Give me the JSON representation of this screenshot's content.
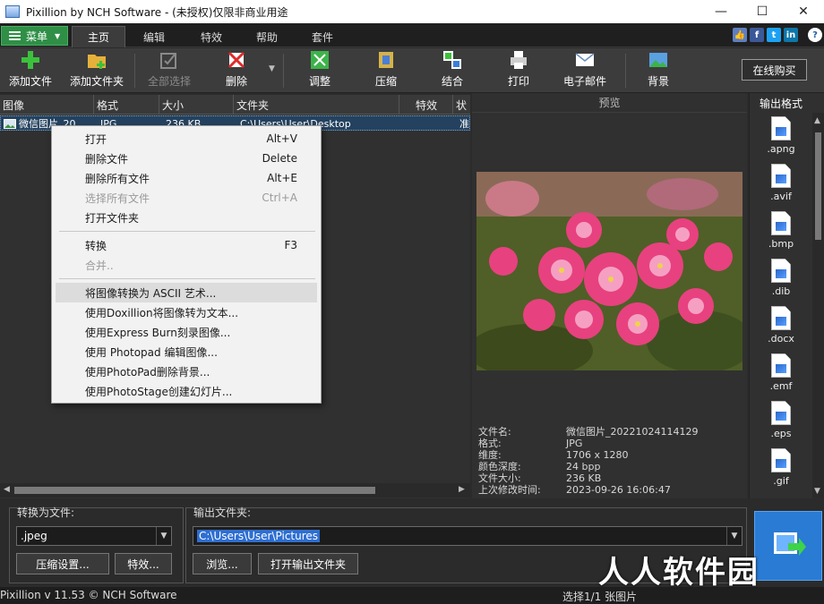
{
  "window": {
    "title": "Pixillion by NCH Software - (未授权)仅限非商业用途",
    "minimize": "—",
    "maximize": "☐",
    "close": "✕"
  },
  "tabs": {
    "menu_label": "菜单",
    "items": [
      "主页",
      "编辑",
      "特效",
      "帮助",
      "套件"
    ]
  },
  "social_icons": [
    "like-icon",
    "facebook-icon",
    "twitter-icon",
    "linkedin-icon",
    "help-icon"
  ],
  "toolbar": {
    "add_file": "添加文件",
    "add_folder": "添加文件夹",
    "select_all": "全部选择",
    "delete": "删除",
    "adjust": "调整",
    "compress": "压缩",
    "combine": "结合",
    "print": "打印",
    "email": "电子邮件",
    "background": "背景",
    "buy_online": "在线购买"
  },
  "file_list": {
    "columns": [
      "图像",
      "格式",
      "大小",
      "文件夹",
      "特效",
      "状"
    ],
    "rows": [
      {
        "name": "微信图片_20...",
        "format": "JPG",
        "size": "236 KB",
        "folder": "C:\\Users\\User\\Desktop",
        "effects": "",
        "status": "准"
      }
    ]
  },
  "context_menu": {
    "items": [
      {
        "label": "打开",
        "shortcut": "Alt+V",
        "enabled": true
      },
      {
        "label": "删除文件",
        "shortcut": "Delete",
        "enabled": true
      },
      {
        "label": "删除所有文件",
        "shortcut": "Alt+E",
        "enabled": true
      },
      {
        "label": "选择所有文件",
        "shortcut": "Ctrl+A",
        "enabled": false
      },
      {
        "label": "打开文件夹",
        "shortcut": "",
        "enabled": true
      },
      {
        "label": "转换",
        "shortcut": "F3",
        "enabled": true
      },
      {
        "label": "合并..",
        "shortcut": "",
        "enabled": false
      },
      {
        "label": "将图像转换为 ASCII 艺术...",
        "shortcut": "",
        "enabled": true
      },
      {
        "label": "使用Doxillion将图像转为文本...",
        "shortcut": "",
        "enabled": true
      },
      {
        "label": "使用Express Burn刻录图像...",
        "shortcut": "",
        "enabled": true
      },
      {
        "label": "使用 Photopad 编辑图像...",
        "shortcut": "",
        "enabled": true
      },
      {
        "label": "使用PhotoPad删除背景...",
        "shortcut": "",
        "enabled": true
      },
      {
        "label": "使用PhotoStage创建幻灯片...",
        "shortcut": "",
        "enabled": true
      }
    ]
  },
  "preview": {
    "title": "预览",
    "info": [
      {
        "key": "文件名:",
        "value": "微信图片_20221024114129"
      },
      {
        "key": "格式:",
        "value": "JPG"
      },
      {
        "key": "维度:",
        "value": "1706 x 1280"
      },
      {
        "key": "颜色深度:",
        "value": "24 bpp"
      },
      {
        "key": "文件大小:",
        "value": "236 KB"
      },
      {
        "key": "上次修改时间:",
        "value": "2023-09-26 16:06:47"
      }
    ]
  },
  "output_formats": {
    "title": "输出格式",
    "items": [
      ".apng",
      ".avif",
      ".bmp",
      ".dib",
      ".docx",
      ".emf",
      ".eps",
      ".gif"
    ]
  },
  "bottom": {
    "convert_to_label": "转换为文件:",
    "format_value": ".jpeg",
    "compress_settings": "压缩设置...",
    "effects": "特效...",
    "output_folder_label": "输出文件夹:",
    "output_folder_value": "C:\\Users\\User\\Pictures",
    "browse": "浏览...",
    "open_output_folder": "打开输出文件夹"
  },
  "status": {
    "version": "Pixillion v 11.53 © NCH Software",
    "selection": "选择1/1 张图片"
  },
  "watermark": "人人软件园",
  "colors": {
    "menu_green": "#2f8f46",
    "selection_blue": "#24425f",
    "convert_blue": "#2a7bd4"
  }
}
